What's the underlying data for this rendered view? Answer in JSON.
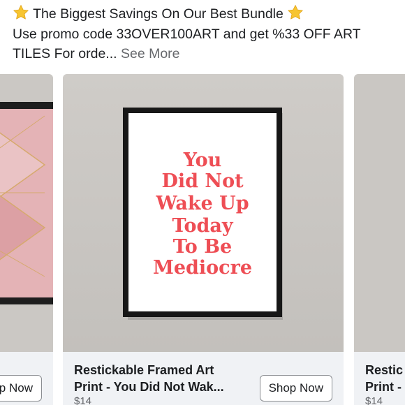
{
  "post": {
    "headline": "The Biggest Savings On Our Best Bundle",
    "line2": "Use promo code 33OVER100ART and get %33 OFF ART",
    "line3": "TILES For orde...",
    "see_more": "See More",
    "emoji_icon": "star-emoji-icon"
  },
  "carousel": {
    "cards": [
      {
        "title_line1": "",
        "title_line2": "",
        "price": "",
        "button": "Shop Now",
        "image": "pink-geometric-framed-print"
      },
      {
        "title_line1": "Restickable Framed Art",
        "title_line2": "Print - You Did Not Wak...",
        "price": "$14",
        "button": "Shop Now",
        "image": "framed-quote-print",
        "quote_lines": [
          "You",
          "Did Not",
          "Wake Up",
          "Today",
          "To Be",
          "Mediocre"
        ]
      },
      {
        "title_line1": "Restic",
        "title_line2": "Print -",
        "price": "$14",
        "button": "",
        "image": "framed-print-partial"
      }
    ]
  },
  "colors": {
    "quote_text": "#ee4e55",
    "card_background": "#f0f2f5",
    "wall": "#c8c5c1",
    "secondary_text": "#65676b"
  }
}
